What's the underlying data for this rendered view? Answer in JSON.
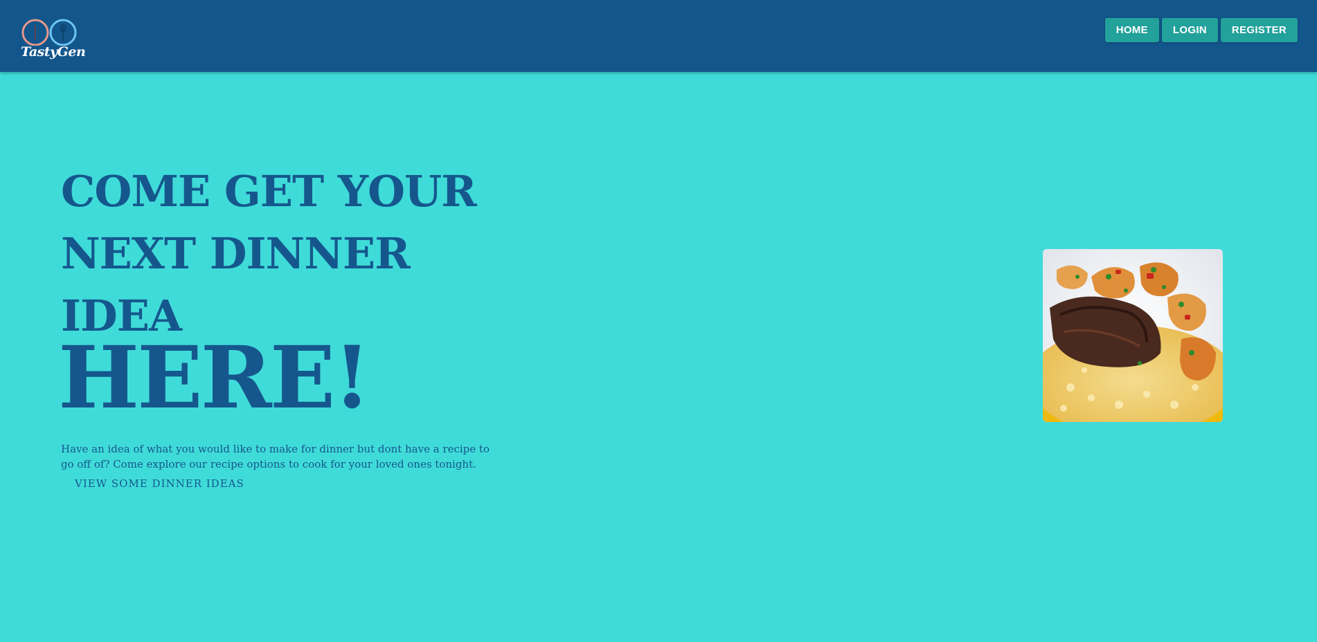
{
  "brand": {
    "name": "TastyGen",
    "logo_colors": [
      "#e8978a",
      "#6ec6f0"
    ]
  },
  "nav": {
    "items": [
      {
        "label": "HOME"
      },
      {
        "label": "LOGIN"
      },
      {
        "label": "REGISTER"
      }
    ]
  },
  "hero": {
    "heading": "COME GET YOUR NEXT DINNER IDEA",
    "heading_emphasis": "HERE!",
    "description": "Have an idea of what you would like to make for dinner but dont have a recipe to go off of? Come explore our recipe options to cook for your loved ones tonight.",
    "cta_label": "VIEW SOME DINNER IDEAS"
  },
  "image": {
    "subject": "steak-with-shrimp-and-risotto"
  },
  "colors": {
    "navbar": "#13568c",
    "background": "#3fdbd9",
    "button": "#23a19b",
    "text": "#15578d"
  }
}
